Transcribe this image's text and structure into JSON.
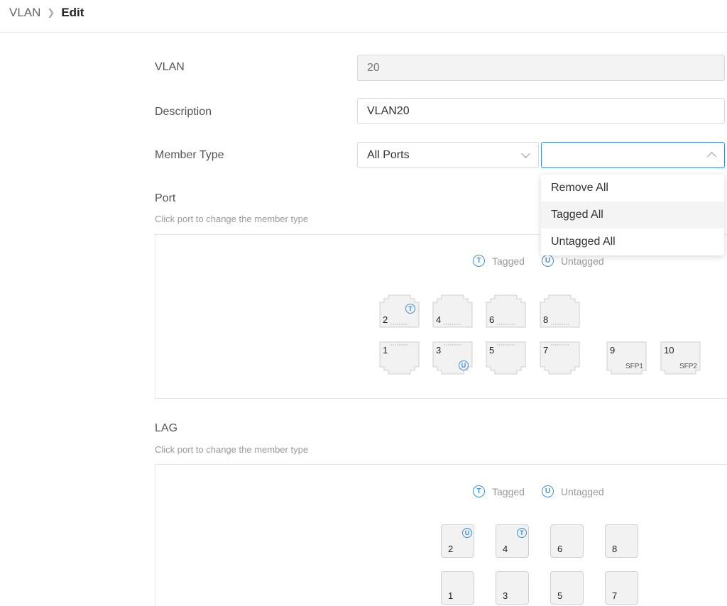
{
  "breadcrumb": {
    "root": "VLAN",
    "current": "Edit"
  },
  "form": {
    "vlan_label": "VLAN",
    "vlan_value": "20",
    "description_label": "Description",
    "description_value": "VLAN20",
    "member_type_label": "Member Type",
    "member_type_value": "All Ports",
    "member_action_value": ""
  },
  "dropdown": {
    "options": [
      "Remove All",
      "Tagged All",
      "Untagged All"
    ],
    "highlighted": "Tagged All"
  },
  "legend": {
    "tagged_symbol": "T",
    "tagged": "Tagged",
    "untagged_symbol": "U",
    "untagged": "Untagged"
  },
  "port_section": {
    "title": "Port",
    "hint": "Click port to change the member type",
    "top_row": [
      {
        "num": "2",
        "member": "T"
      },
      {
        "num": "4",
        "member": ""
      },
      {
        "num": "6",
        "member": ""
      },
      {
        "num": "8",
        "member": ""
      }
    ],
    "bottom_row": [
      {
        "num": "1",
        "member": ""
      },
      {
        "num": "3",
        "member": "U"
      },
      {
        "num": "5",
        "member": ""
      },
      {
        "num": "7",
        "member": ""
      }
    ],
    "sfp": [
      {
        "num": "9",
        "label": "SFP1"
      },
      {
        "num": "10",
        "label": "SFP2"
      }
    ]
  },
  "lag_section": {
    "title": "LAG",
    "hint": "Click port to change the member type",
    "top_row": [
      {
        "num": "2",
        "member": "U"
      },
      {
        "num": "4",
        "member": "T"
      },
      {
        "num": "6",
        "member": ""
      },
      {
        "num": "8",
        "member": ""
      }
    ],
    "bottom_row": [
      {
        "num": "1",
        "member": ""
      },
      {
        "num": "3",
        "member": ""
      },
      {
        "num": "5",
        "member": ""
      },
      {
        "num": "7",
        "member": ""
      }
    ]
  },
  "colors": {
    "accent": "#3a8fd9",
    "border": "#d9d9d9",
    "port_fill": "#f2f2f2"
  }
}
